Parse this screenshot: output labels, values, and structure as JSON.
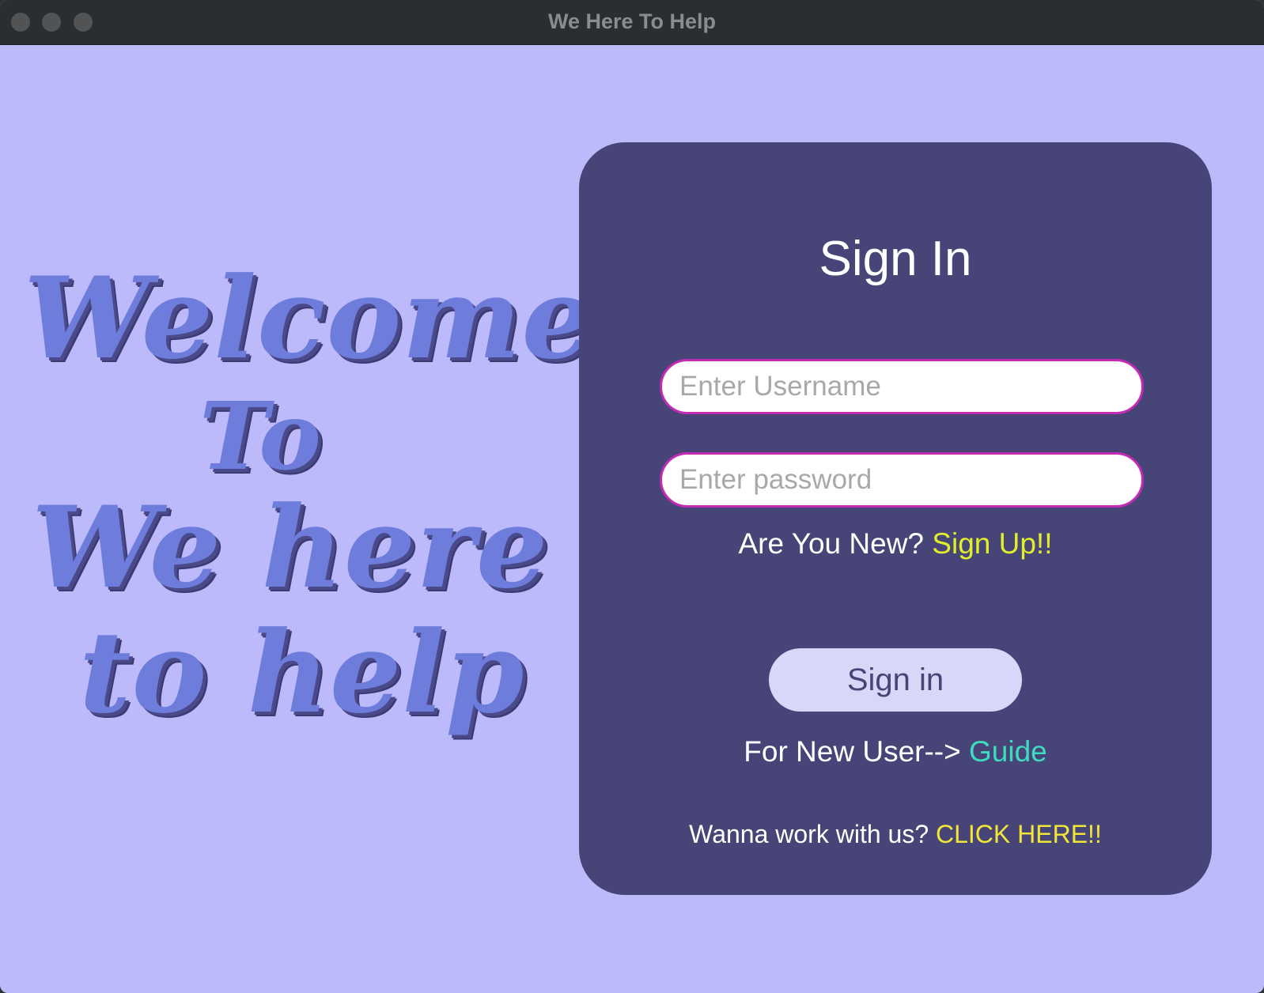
{
  "window": {
    "title": "We Here To Help"
  },
  "welcome": {
    "line1": "Welcome",
    "line2": "To",
    "line3": "We here",
    "line4": "to help"
  },
  "signin_card": {
    "heading": "Sign In",
    "username_placeholder": "Enter Username",
    "password_placeholder": "Enter password",
    "new_prompt": "Are You New?",
    "signup_link": "Sign Up!!",
    "signin_button": "Sign in",
    "guide_prompt": "For New User-->",
    "guide_link": "Guide",
    "work_prompt": "Wanna work with us?",
    "work_link": "CLICK HERE!!"
  },
  "colors": {
    "background": "#bcbafa",
    "card": "#474577",
    "field_border": "#c22bb4",
    "signup_link": "#e1ef2a",
    "guide_link": "#3ddbc0",
    "work_link": "#f1e53a",
    "welcome_text": "#6e7ddc"
  }
}
